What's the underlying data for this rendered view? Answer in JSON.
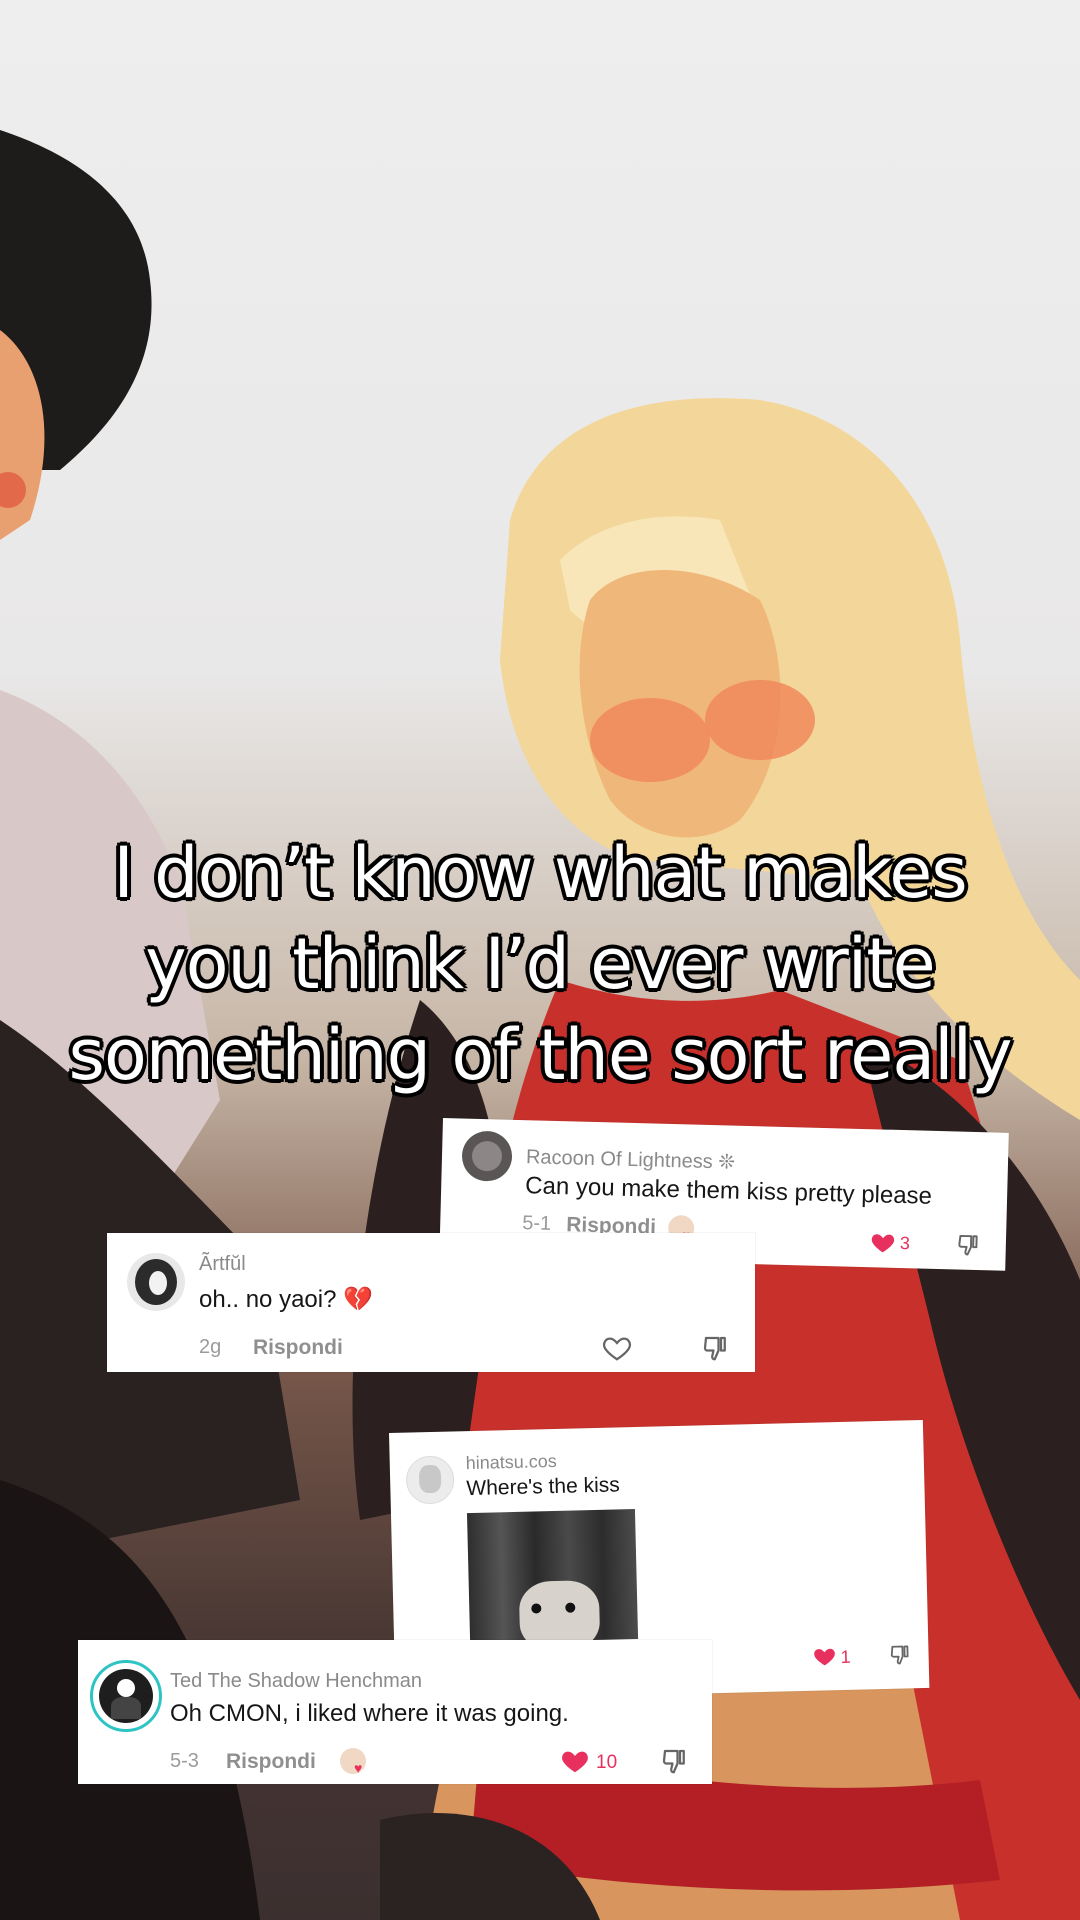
{
  "caption": {
    "lines": [
      "I don’t know what makes",
      "you think I’d ever write",
      "something of the sort really"
    ]
  },
  "comments": [
    {
      "username": "Racoon Of Lightness ❊",
      "text": "Can you make them kiss pretty please",
      "date": "5-1",
      "reply": "Rispondi",
      "likes": "3",
      "liked": true
    },
    {
      "username": "Ãrtfŭl",
      "text": "oh.. no yaoi? 💔",
      "date": "2g",
      "reply": "Rispondi",
      "liked": false
    },
    {
      "username": "hinatsu.cos",
      "text": "Where's the kiss",
      "likes": "1",
      "liked": true
    },
    {
      "username": "Ted The Shadow Henchman",
      "text": "Oh CMON, i liked where it was going.",
      "date": "5-3",
      "reply": "Rispondi",
      "likes": "10",
      "liked": true
    }
  ],
  "colors": {
    "like": "#e8305e",
    "muted": "#8f8f8f"
  }
}
